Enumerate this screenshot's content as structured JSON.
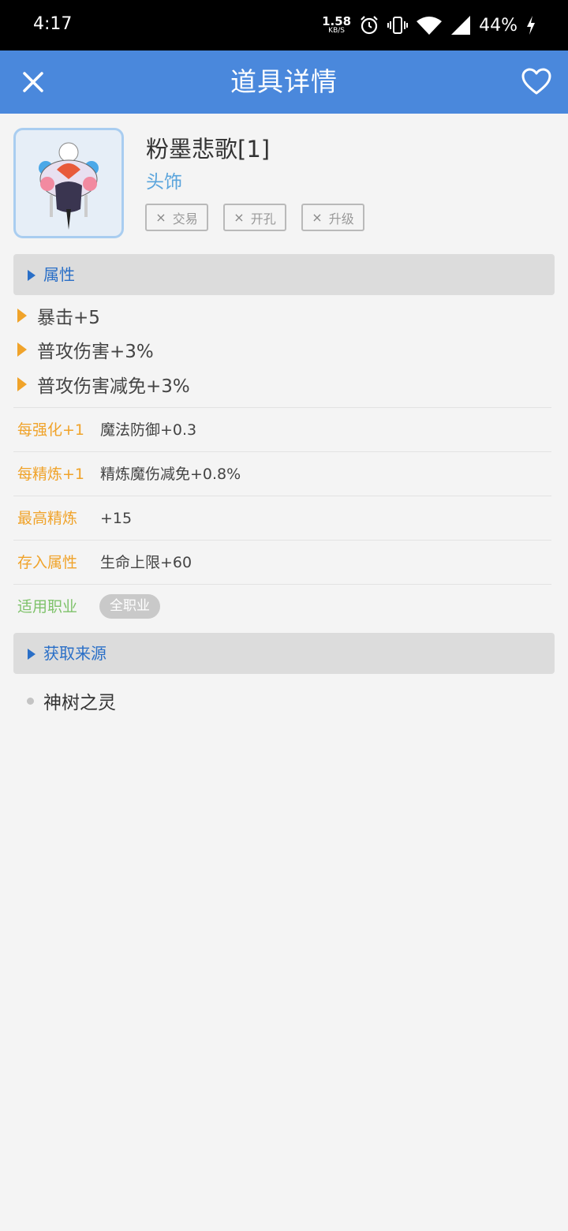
{
  "status_bar": {
    "time": "4:17",
    "net_speed_value": "1.58",
    "net_speed_unit": "KB/S",
    "battery_percent": "44%",
    "icons": [
      "alarm-icon",
      "vibrate-icon",
      "wifi-icon",
      "signal-icon",
      "charging-icon"
    ]
  },
  "app_bar": {
    "title": "道具详情",
    "close_icon": "close-icon",
    "favorite_icon": "heart-outline-icon",
    "background": "#4a88dc"
  },
  "item": {
    "name": "粉墨悲歌[1]",
    "type": "头饰",
    "tags": [
      {
        "mark": "×",
        "label": "交易"
      },
      {
        "mark": "×",
        "label": "开孔"
      },
      {
        "mark": "×",
        "label": "升级"
      }
    ]
  },
  "attributes_section": {
    "title": "属性",
    "items": [
      "暴击+5",
      "普攻伤害+3%",
      "普攻伤害减免+3%"
    ]
  },
  "details": [
    {
      "key": "每强化+1",
      "value": "魔法防御+0.3"
    },
    {
      "key": "每精炼+1",
      "value": "精炼魔伤减免+0.8%"
    },
    {
      "key": "最高精炼",
      "value": "+15"
    },
    {
      "key": "存入属性",
      "value": "生命上限+60"
    }
  ],
  "profession": {
    "key": "适用职业",
    "value": "全职业"
  },
  "source_section": {
    "title": "获取来源",
    "items": [
      "神树之灵"
    ]
  },
  "colors": {
    "accent_blue": "#2a6fc7",
    "orange": "#f0a32a",
    "green": "#7ec26a",
    "type_blue": "#5aa4dc"
  }
}
